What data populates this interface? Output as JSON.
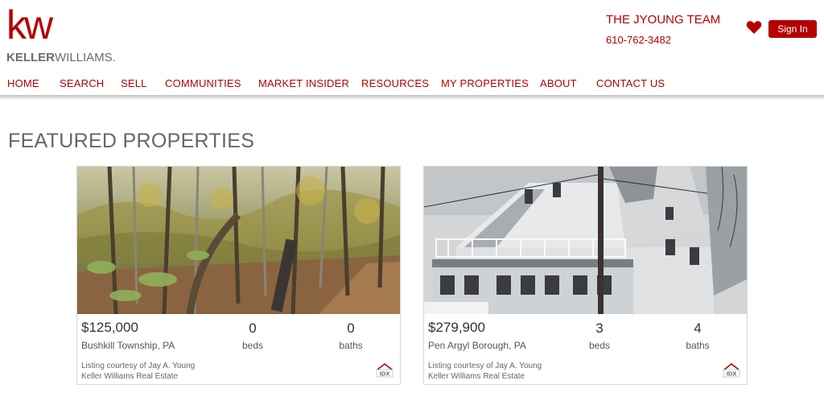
{
  "brand": {
    "logo_mark": "kw",
    "logo_bold": "KELLER",
    "logo_light": "WILLIAMS",
    "logo_suffix": ".",
    "accent_color": "#b40101"
  },
  "header": {
    "team_name": "THE JYOUNG TEAM",
    "phone": "610-762-3482",
    "favorites_icon": "heart-icon",
    "signin_label": "Sign In"
  },
  "nav": {
    "items": [
      {
        "label": "HOME"
      },
      {
        "label": "SEARCH"
      },
      {
        "label": "SELL"
      },
      {
        "label": "COMMUNITIES"
      },
      {
        "label": "MARKET INSIDER"
      },
      {
        "label": "RESOURCES"
      },
      {
        "label": "MY PROPERTIES"
      },
      {
        "label": "ABOUT"
      },
      {
        "label": "CONTACT US"
      }
    ]
  },
  "featured": {
    "title": "FEATURED PROPERTIES",
    "listings": [
      {
        "price": "$125,000",
        "location": "Bushkill Township, PA",
        "beds": "0",
        "beds_label": "beds",
        "baths": "0",
        "baths_label": "baths",
        "courtesy_line1": "Listing courtesy of Jay A. Young",
        "courtesy_line2": "Keller Williams Real Estate",
        "badge": "IDX",
        "photo": "wooded-lot-photo"
      },
      {
        "price": "$279,900",
        "location": "Pen Argyl Borough, PA",
        "beds": "3",
        "beds_label": "beds",
        "baths": "4",
        "baths_label": "baths",
        "courtesy_line1": "Listing courtesy of Jay A. Young",
        "courtesy_line2": "Keller Williams Real Estate",
        "badge": "IDX",
        "photo": "white-house-photo"
      }
    ]
  }
}
